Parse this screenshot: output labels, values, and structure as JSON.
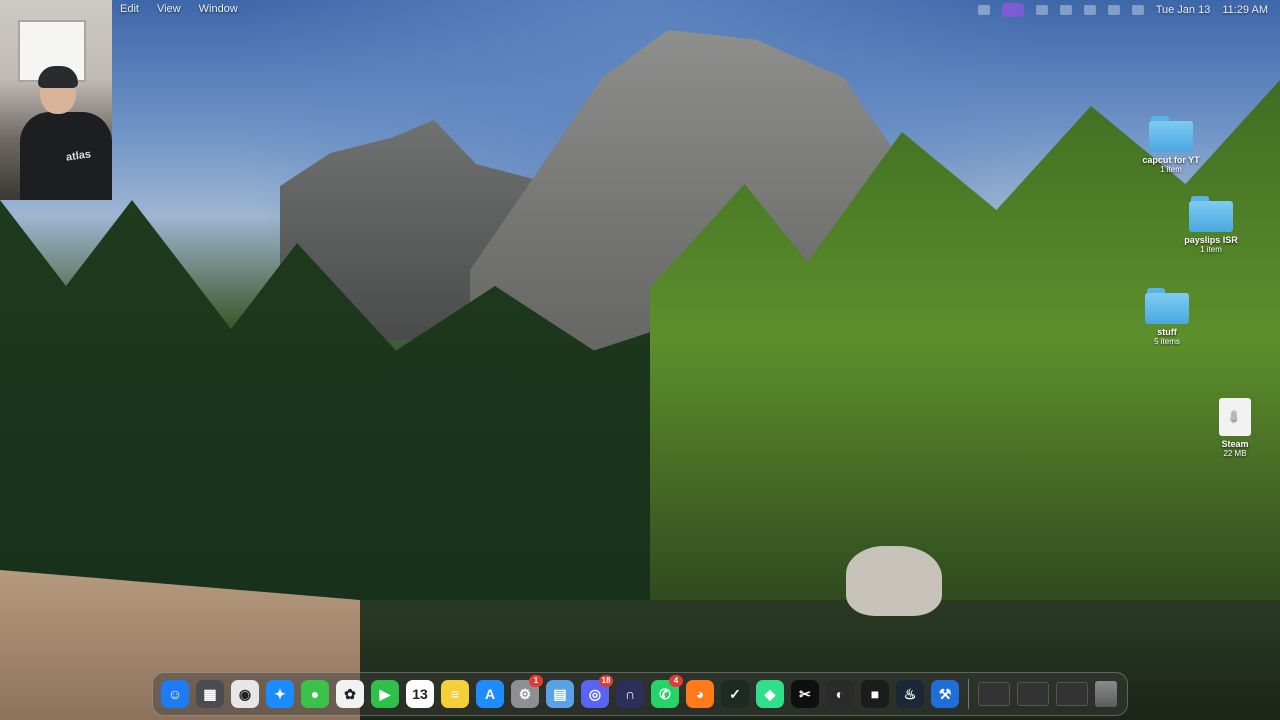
{
  "menubar": {
    "items": [
      "Edit",
      "View",
      "Window"
    ],
    "date": "Tue Jan 13",
    "time": "11:29 AM"
  },
  "desktop_icons": [
    {
      "name": "capcut for YT",
      "sub": "1 item",
      "type": "folder"
    },
    {
      "name": "payslips ISR",
      "sub": "1 item",
      "type": "folder"
    },
    {
      "name": "stuff",
      "sub": "5 items",
      "type": "folder"
    },
    {
      "name": "Steam",
      "sub": "22 MB",
      "type": "dmg"
    }
  ],
  "webcam": {
    "shirt_text": "atlas"
  },
  "dock": {
    "apps": [
      {
        "name": "Finder",
        "color": "#1e7cf2",
        "glyph": "☺"
      },
      {
        "name": "Launchpad",
        "color": "#4b4b52",
        "glyph": "▦"
      },
      {
        "name": "Chrome",
        "color": "#e6e6e6",
        "glyph": "◉"
      },
      {
        "name": "Safari",
        "color": "#1a8cff",
        "glyph": "✦"
      },
      {
        "name": "Messages",
        "color": "#3ac24a",
        "glyph": "●"
      },
      {
        "name": "Photos",
        "color": "#f2f2f2",
        "glyph": "✿"
      },
      {
        "name": "FaceTime",
        "color": "#2fbf4b",
        "glyph": "▶"
      },
      {
        "name": "Calendar",
        "color": "#ffffff",
        "glyph": "13"
      },
      {
        "name": "Notes",
        "color": "#f4cf3a",
        "glyph": "≡"
      },
      {
        "name": "App Store",
        "color": "#1e8cff",
        "glyph": "A"
      },
      {
        "name": "System Settings",
        "color": "#8e8e93",
        "glyph": "⚙",
        "badge": "1"
      },
      {
        "name": "Preview",
        "color": "#5aa2e8",
        "glyph": "▤"
      },
      {
        "name": "Discord",
        "color": "#5865f2",
        "glyph": "◎",
        "badge": "18"
      },
      {
        "name": "Arc",
        "color": "#2b2f5a",
        "glyph": "∩"
      },
      {
        "name": "WhatsApp",
        "color": "#25d366",
        "glyph": "✆",
        "badge": "4"
      },
      {
        "name": "Firefox",
        "color": "#ff7a1a",
        "glyph": "◕"
      },
      {
        "name": "CapCut Helper",
        "color": "#1d2b24",
        "glyph": "✓"
      },
      {
        "name": "Cursor",
        "color": "#2fe08a",
        "glyph": "◆"
      },
      {
        "name": "CapCut",
        "color": "#0f0f0f",
        "glyph": "✂"
      },
      {
        "name": "OBS",
        "color": "#2b2b2b",
        "glyph": "◐"
      },
      {
        "name": "Minecraft",
        "color": "#1c1c1c",
        "glyph": "■"
      },
      {
        "name": "Steam",
        "color": "#1b2838",
        "glyph": "♨"
      },
      {
        "name": "Xcode Tool",
        "color": "#1e6fd9",
        "glyph": "⚒"
      }
    ],
    "recent_thumbs": 3
  }
}
